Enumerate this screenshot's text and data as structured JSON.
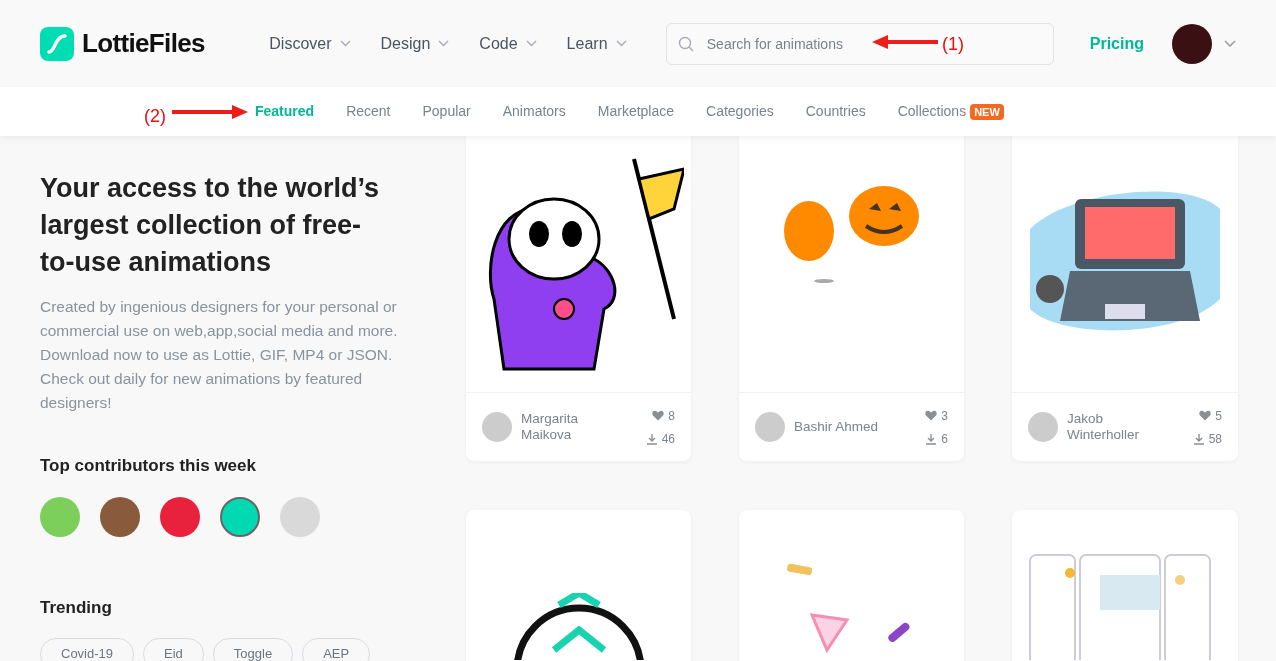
{
  "header": {
    "logo": "LottieFiles",
    "menu": [
      {
        "label": "Discover"
      },
      {
        "label": "Design"
      },
      {
        "label": "Code"
      },
      {
        "label": "Learn"
      }
    ],
    "search": {
      "placeholder": "Search for animations"
    },
    "pricing": "Pricing"
  },
  "tabs": [
    {
      "label": "Featured",
      "selected": true
    },
    {
      "label": "Recent",
      "selected": false
    },
    {
      "label": "Popular",
      "selected": false
    },
    {
      "label": "Animators",
      "selected": false
    },
    {
      "label": "Marketplace",
      "selected": false
    },
    {
      "label": "Categories",
      "selected": false
    },
    {
      "label": "Countries",
      "selected": false
    },
    {
      "label": "Collections",
      "selected": false,
      "badge": "NEW"
    }
  ],
  "hero": {
    "title": "Your access to the world’s largest collection of free-to-use animations",
    "description": "Created by ingenious designers for your personal or commercial use on web,app,social media and more. Download now to use as Lottie, GIF, MP4 or JSON. Check out daily for new animations by featured designers!"
  },
  "contributors": {
    "title": "Top contributors this week"
  },
  "trending": {
    "title": "Trending",
    "tags": [
      "Covid-19",
      "Eid",
      "Toggle",
      "AEP"
    ]
  },
  "cards": [
    {
      "kind": "full",
      "author": "Margarita Maikova",
      "likes": "8",
      "downloads": "46"
    },
    {
      "kind": "full",
      "author": "Bashir Ahmed",
      "likes": "3",
      "downloads": "6"
    },
    {
      "kind": "full",
      "author": "Jakob Winterholler",
      "likes": "5",
      "downloads": "58"
    },
    {
      "kind": "preview"
    },
    {
      "kind": "preview"
    },
    {
      "kind": "preview"
    }
  ],
  "annotations": [
    {
      "label": "(1)"
    },
    {
      "label": "(2)"
    }
  ]
}
